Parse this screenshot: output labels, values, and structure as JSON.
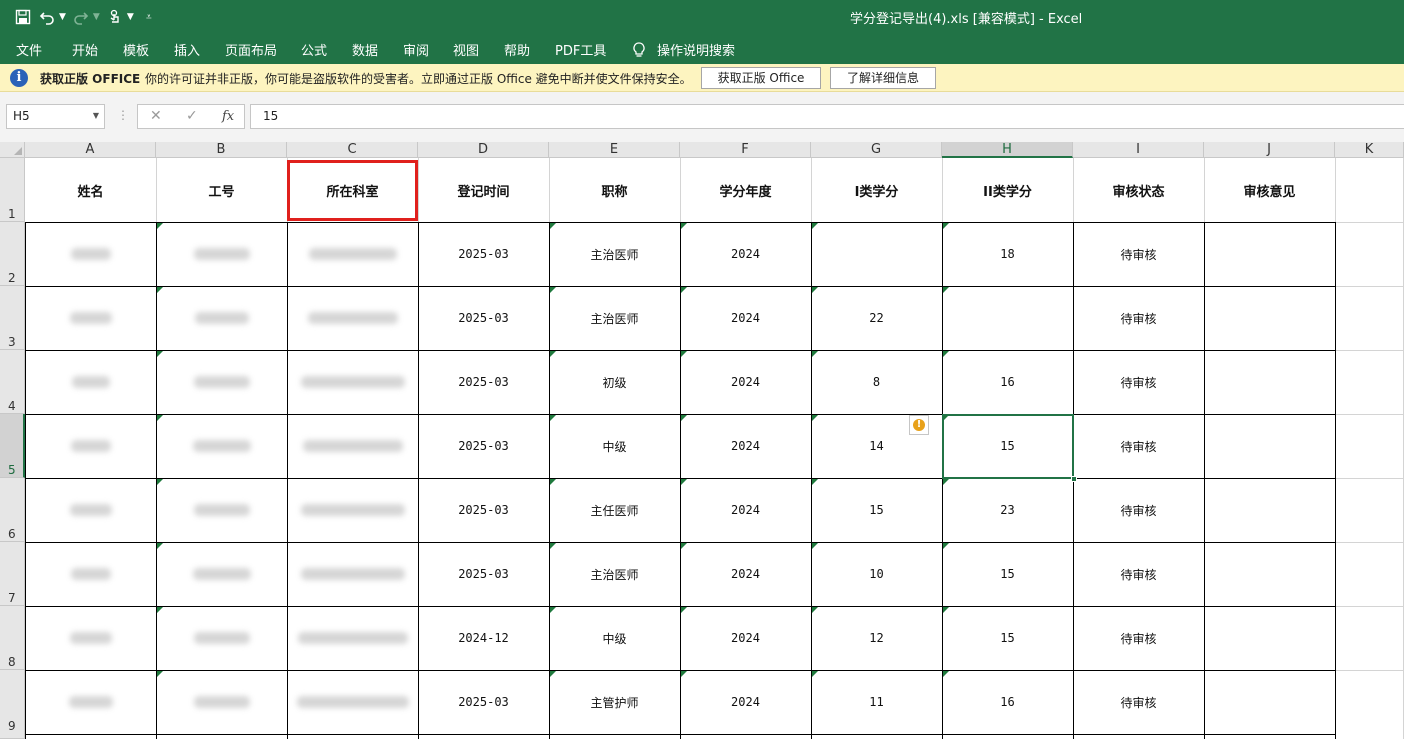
{
  "window": {
    "title": "学分登记导出(4).xls  [兼容模式]  -  Excel"
  },
  "ribbon": {
    "tabs": [
      "文件",
      "开始",
      "模板",
      "插入",
      "页面布局",
      "公式",
      "数据",
      "审阅",
      "视图",
      "帮助",
      "PDF工具"
    ],
    "tell_me": "操作说明搜索"
  },
  "message_bar": {
    "title": "获取正版 OFFICE",
    "text": "你的许可证并非正版，你可能是盗版软件的受害者。立即通过正版 Office 避免中断并使文件保持安全。",
    "button_primary": "获取正版 Office",
    "button_secondary": "了解详细信息"
  },
  "formula_bar": {
    "name_box": "H5",
    "value": "15"
  },
  "sheet": {
    "columns": [
      "A",
      "B",
      "C",
      "D",
      "E",
      "F",
      "G",
      "H",
      "I",
      "J",
      "K"
    ],
    "selected_column": "H",
    "selected_row": "5",
    "row_numbers": [
      "1",
      "2",
      "3",
      "4",
      "5",
      "6",
      "7",
      "8",
      "9"
    ],
    "headers": [
      "姓名",
      "工号",
      "所在科室",
      "登记时间",
      "职称",
      "学分年度",
      "I类学分",
      "II类学分",
      "审核状态",
      "审核意见"
    ],
    "rows": [
      {
        "time": "2025-03",
        "title": "主治医师",
        "year": "2024",
        "c1": "",
        "c2": "18",
        "status": "待审核"
      },
      {
        "time": "2025-03",
        "title": "主治医师",
        "year": "2024",
        "c1": "22",
        "c2": "",
        "status": "待审核"
      },
      {
        "time": "2025-03",
        "title": "初级",
        "year": "2024",
        "c1": "8",
        "c2": "16",
        "status": "待审核"
      },
      {
        "time": "2025-03",
        "title": "中级",
        "year": "2024",
        "c1": "14",
        "c2": "15",
        "status": "待审核"
      },
      {
        "time": "2025-03",
        "title": "主任医师",
        "year": "2024",
        "c1": "15",
        "c2": "23",
        "status": "待审核"
      },
      {
        "time": "2025-03",
        "title": "主治医师",
        "year": "2024",
        "c1": "10",
        "c2": "15",
        "status": "待审核"
      },
      {
        "time": "2024-12",
        "title": "中级",
        "year": "2024",
        "c1": "12",
        "c2": "15",
        "status": "待审核"
      },
      {
        "time": "2025-03",
        "title": "主管护师",
        "year": "2024",
        "c1": "11",
        "c2": "16",
        "status": "待审核"
      }
    ]
  },
  "colors": {
    "excel_green": "#217346",
    "highlight_red": "#e0201d",
    "message_bg": "#fdf4c0"
  }
}
